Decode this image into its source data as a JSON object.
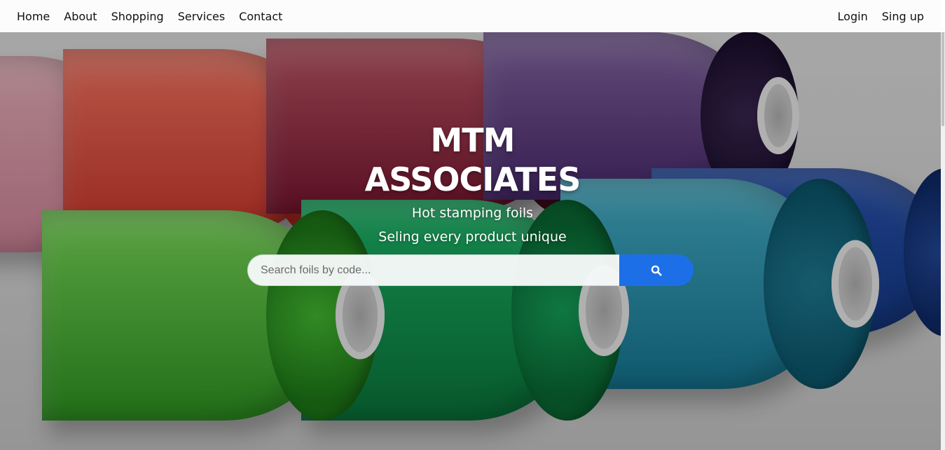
{
  "nav": {
    "left": [
      {
        "label": "Home"
      },
      {
        "label": "About"
      },
      {
        "label": "Shopping"
      },
      {
        "label": "Services"
      },
      {
        "label": "Contact"
      }
    ],
    "right": [
      {
        "label": "Login"
      },
      {
        "label": "Sing up"
      }
    ]
  },
  "hero": {
    "title": "MTM ASSOCIATES",
    "subtitle": "Hot stamping foils",
    "tagline": "Seling every product unique"
  },
  "search": {
    "placeholder": "Search foils by code...",
    "value": "",
    "button_icon": "search-icon"
  },
  "colors": {
    "search_button": "#1d6fe8",
    "navbar_bg": "#ffffff"
  }
}
